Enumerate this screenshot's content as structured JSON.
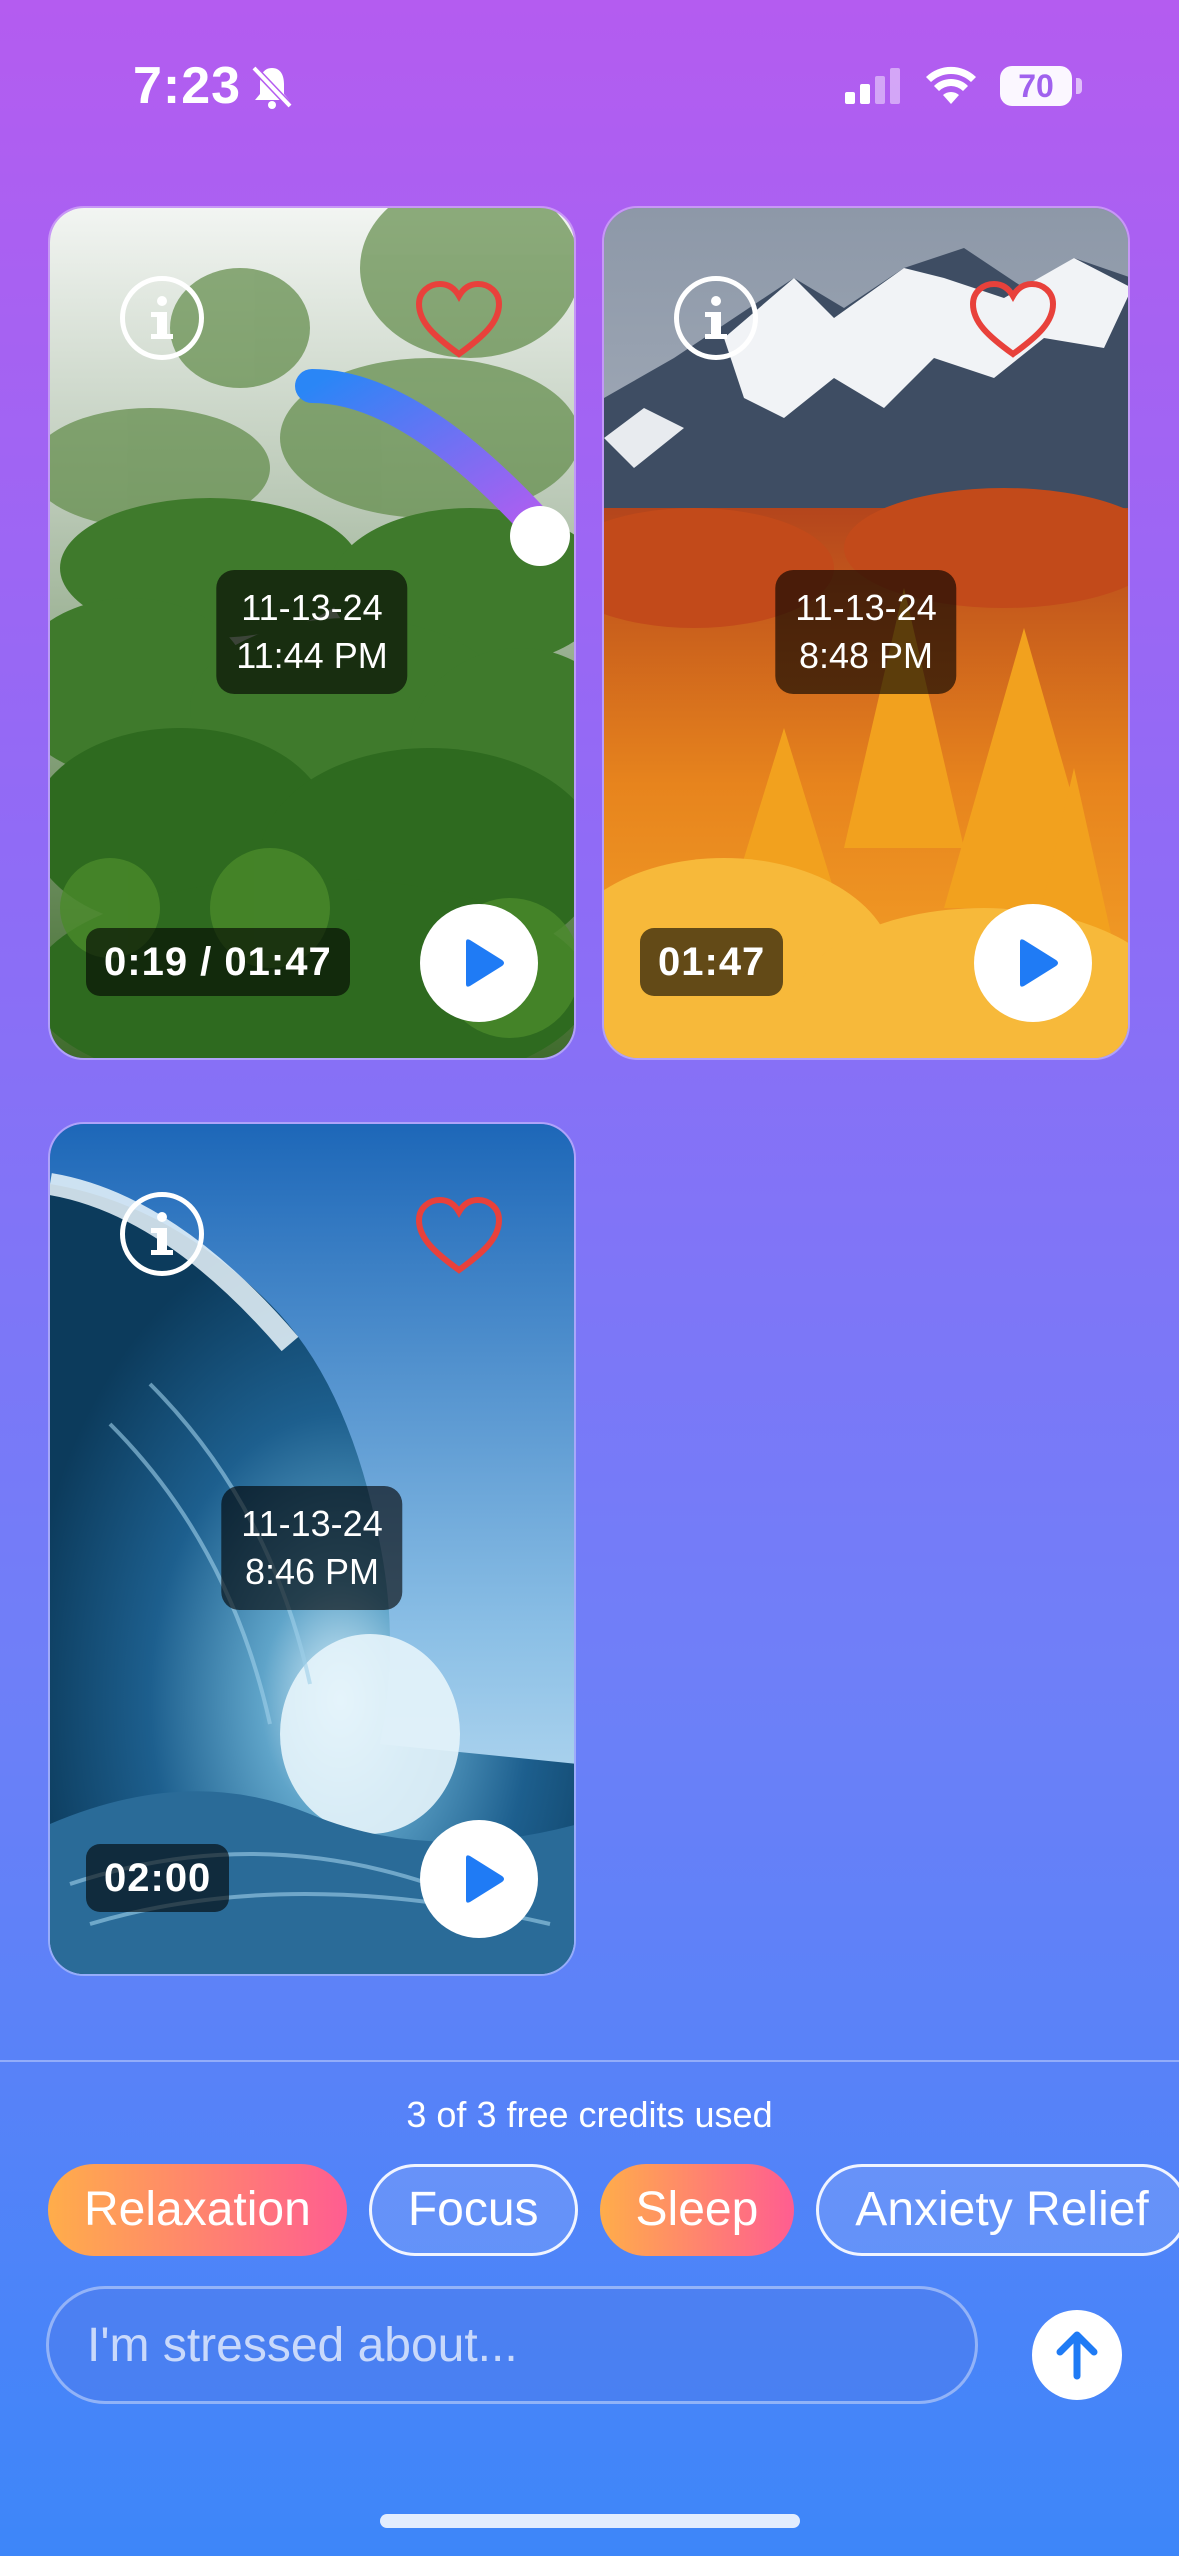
{
  "status_bar": {
    "time": "7:23",
    "battery": "70"
  },
  "cards": [
    {
      "date": "11-13-24",
      "time": "11:44 PM",
      "duration": "0:19 / 01:47",
      "favorite": false,
      "progress": 0.18
    },
    {
      "date": "11-13-24",
      "time": "8:48 PM",
      "duration": "01:47",
      "favorite": false
    },
    {
      "date": "11-13-24",
      "time": "8:46 PM",
      "duration": "02:00",
      "favorite": false
    }
  ],
  "credits_text": "3 of 3 free credits used",
  "chips": [
    "Relaxation",
    "Focus",
    "Sleep",
    "Anxiety Relief"
  ],
  "input": {
    "placeholder": "I'm stressed about..."
  },
  "icons": {
    "info": "info-icon",
    "heart": "heart-icon",
    "play": "play-icon",
    "send": "arrow-up-icon",
    "bell": "bell-slash-icon",
    "wifi": "wifi-icon",
    "signal": "signal-icon"
  },
  "colors": {
    "accent": "#1f7bf5",
    "heart": "#e8413b"
  }
}
